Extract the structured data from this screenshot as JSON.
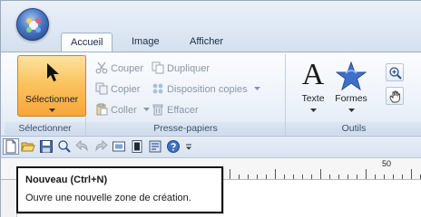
{
  "tabs": [
    {
      "label": "Accueil",
      "active": true
    },
    {
      "label": "Image",
      "active": false
    },
    {
      "label": "Afficher",
      "active": false
    }
  ],
  "ribbon": {
    "select_group": {
      "button_label": "Sélectionner",
      "group_label": "Sélectionner"
    },
    "clipboard_group": {
      "couper": "Couper",
      "dupliquer": "Dupliquer",
      "copier": "Copier",
      "disposition": "Disposition copies",
      "coller": "Coller",
      "effacer": "Effacer",
      "group_label": "Presse-papiers"
    },
    "tools_group": {
      "texte": "Texte",
      "texte_glyph": "A",
      "formes": "Formes",
      "group_label": "Outils"
    }
  },
  "ruler": {
    "label_50": "50"
  },
  "tooltip": {
    "title": "Nouveau (Ctrl+N)",
    "description": "Ouvre une nouvelle zone de création."
  },
  "colors": {
    "accent_selected": "#f7a53a",
    "ribbon_bg": "#eef3fa",
    "star_blue": "#3e6fc9"
  }
}
